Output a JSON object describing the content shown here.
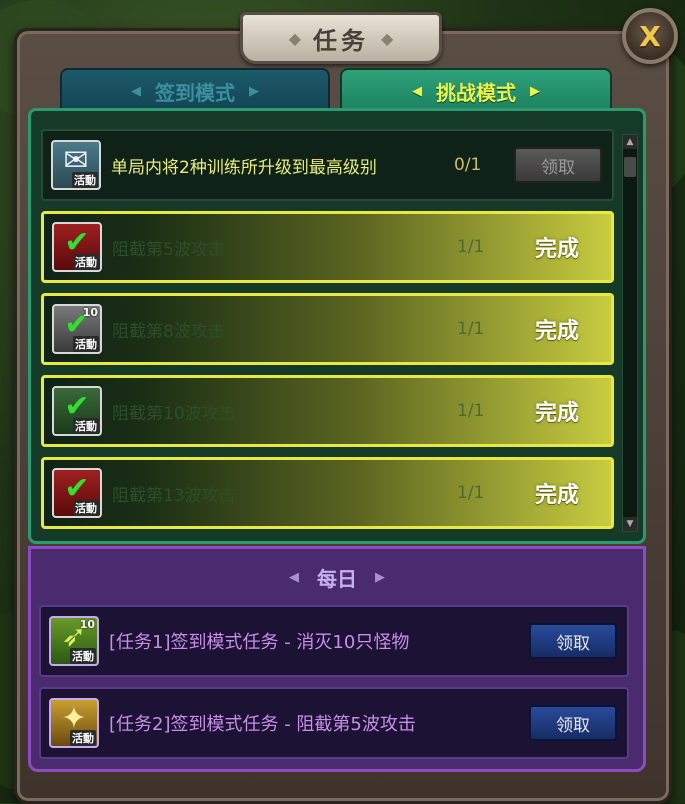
{
  "window": {
    "title": "任务",
    "close_label": "X"
  },
  "tabs": [
    {
      "label": "签到模式",
      "active": false
    },
    {
      "label": "挑战模式",
      "active": true
    }
  ],
  "challenge_tasks": [
    {
      "icon": "gift-icon",
      "icon_badge": "活動",
      "text": "单局内将2种训练所升级到最高级别",
      "progress": "0/1",
      "action": "领取",
      "completed": false
    },
    {
      "icon": "checkmark-red-icon",
      "icon_badge": "活動",
      "text": "阻截第5波攻击",
      "progress": "1/1",
      "action": "完成",
      "completed": true
    },
    {
      "icon": "checkmark-grey-icon",
      "icon_badge": "活動",
      "icon_level": "10",
      "text": "阻截第8波攻击",
      "progress": "1/1",
      "action": "完成",
      "completed": true
    },
    {
      "icon": "checkmark-green-icon",
      "icon_badge": "活動",
      "text": "阻截第10波攻击",
      "progress": "1/1",
      "action": "完成",
      "completed": true
    },
    {
      "icon": "checkmark-red-icon",
      "icon_badge": "活動",
      "text": "阻截第13波攻击",
      "progress": "1/1",
      "action": "完成",
      "completed": true
    }
  ],
  "daily": {
    "header": "每日",
    "tasks": [
      {
        "icon": "arrow-icon",
        "icon_badge": "活動",
        "icon_level": "10",
        "text": "[任务1]签到模式任务 - 消灭10只怪物",
        "action": "领取"
      },
      {
        "icon": "treasure-chest-icon",
        "icon_badge": "活動",
        "text": "[任务2]签到模式任务 - 阻截第5波攻击",
        "action": "领取"
      }
    ]
  },
  "colors": {
    "accent_yellow": "#e9f44a",
    "complete_border": "#e8e840",
    "panel_green": "#163a28",
    "panel_purple": "#4a2c6e",
    "button_blue": "#2a4a9a"
  }
}
